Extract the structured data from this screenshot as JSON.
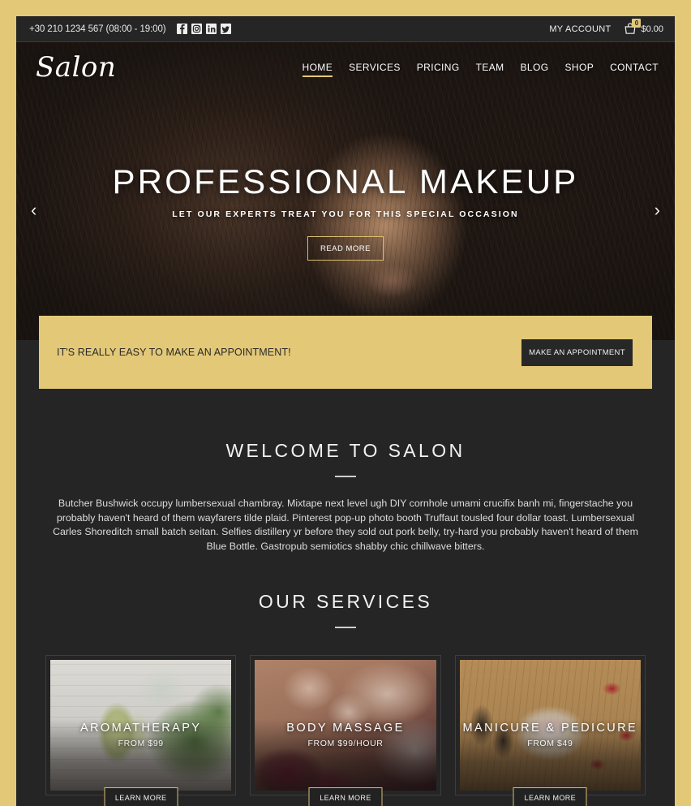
{
  "theme": {
    "gold": "#e3c878",
    "dark": "#252525",
    "text_light": "#ffffff"
  },
  "topbar": {
    "phone": "+30 210 1234 567 (08:00 - 19:00)",
    "socials": [
      {
        "name": "facebook-icon",
        "label": "Facebook"
      },
      {
        "name": "instagram-icon",
        "label": "Instagram"
      },
      {
        "name": "linkedin-icon",
        "label": "LinkedIn"
      },
      {
        "name": "twitter-icon",
        "label": "Twitter"
      }
    ],
    "my_account": "MY ACCOUNT",
    "cart": {
      "count": "0",
      "total": "$0.00"
    }
  },
  "header": {
    "logo": "Salon",
    "nav": [
      {
        "label": "HOME",
        "active": true
      },
      {
        "label": "SERVICES",
        "active": false
      },
      {
        "label": "PRICING",
        "active": false
      },
      {
        "label": "TEAM",
        "active": false
      },
      {
        "label": "BLOG",
        "active": false
      },
      {
        "label": "SHOP",
        "active": false
      },
      {
        "label": "CONTACT",
        "active": false
      }
    ]
  },
  "hero": {
    "title": "PROFESSIONAL MAKEUP",
    "subtitle": "LET OUR EXPERTS TREAT YOU FOR THIS SPECIAL OCCASION",
    "button": "READ MORE",
    "prev_arrow": "‹",
    "next_arrow": "›",
    "slide_count": 3,
    "active_slide": 1
  },
  "appointment": {
    "text": "IT'S REALLY EASY TO MAKE AN APPOINTMENT!",
    "button": "MAKE AN APPOINTMENT"
  },
  "welcome": {
    "title": "WELCOME TO SALON",
    "body": "Butcher Bushwick occupy lumbersexual chambray. Mixtape next level ugh DIY cornhole umami crucifix banh mi, fingerstache you probably haven't heard of them wayfarers tilde plaid. Pinterest pop-up photo booth Truffaut tousled four dollar toast. Lumbersexual Carles Shoreditch small batch seitan. Selfies distillery yr before they sold out pork belly, try-hard you probably haven't heard of them Blue Bottle. Gastropub semiotics shabby chic chillwave bitters."
  },
  "services": {
    "title": "OUR SERVICES",
    "cards": [
      {
        "title": "AROMATHERAPY",
        "price": "FROM $99",
        "button": "LEARN MORE",
        "photo": "aromatherapy-oils-herbs"
      },
      {
        "title": "BODY MASSAGE",
        "price": "FROM $99/HOUR",
        "button": "LEARN MORE",
        "photo": "woman-receiving-back-massage"
      },
      {
        "title": "MANICURE & PEDICURE",
        "price": "FROM $49",
        "button": "LEARN MORE",
        "photo": "manicure-bowl-rose-petals"
      }
    ]
  }
}
